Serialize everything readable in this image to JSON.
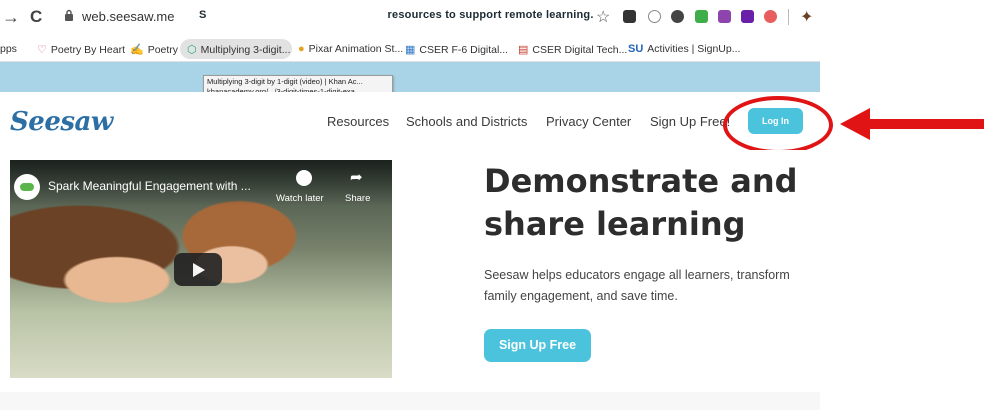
{
  "browser": {
    "url": "web.seesaw.me",
    "bookmarks": [
      {
        "label": "pps",
        "icon": ""
      },
      {
        "label": "Poetry By Heart",
        "icon": "♡"
      },
      {
        "label": "Poetry",
        "icon": "✍"
      },
      {
        "label": "Multiplying 3-digit...",
        "icon": "⬡"
      },
      {
        "label": "Pixar Animation St...",
        "icon": "●"
      },
      {
        "label": "CSER F-6 Digital...",
        "icon": "▦"
      },
      {
        "label": "CSER Digital Tech...",
        "icon": "▤"
      },
      {
        "label": "Activities | SignUp...",
        "icon": "SU"
      }
    ],
    "tooltip_line1": "Multiplying 3-digit by 1-digit (video) | Khan Ac...",
    "tooltip_line2": "khanacademy.org/.../3-digit-times-1-digit-exa...",
    "extension_colors": [
      "#333333",
      "#888888",
      "#444444",
      "#3fae4a",
      "#8e44ad",
      "#6a1fa8",
      "#e85d5d"
    ]
  },
  "banner": {
    "prefix": "S",
    "text": "resources to support remote learning."
  },
  "header": {
    "logo": "Seesaw",
    "nav": [
      "Resources",
      "Schools and Districts",
      "Privacy Center",
      "Sign Up Free!"
    ],
    "login_label": "Log In"
  },
  "video": {
    "title": "Spark Meaningful Engagement with ...",
    "watch_later": "Watch later",
    "share": "Share"
  },
  "hero": {
    "title_line1": "Demonstrate and",
    "title_line2": "share learning",
    "description": "Seesaw helps educators engage all learners, transform family engagement, and save time.",
    "cta": "Sign Up Free"
  },
  "colors": {
    "accent": "#4bc3dd",
    "banner": "#a9d3e6",
    "logo": "#2c6fa5",
    "annotation": "#e01414"
  }
}
